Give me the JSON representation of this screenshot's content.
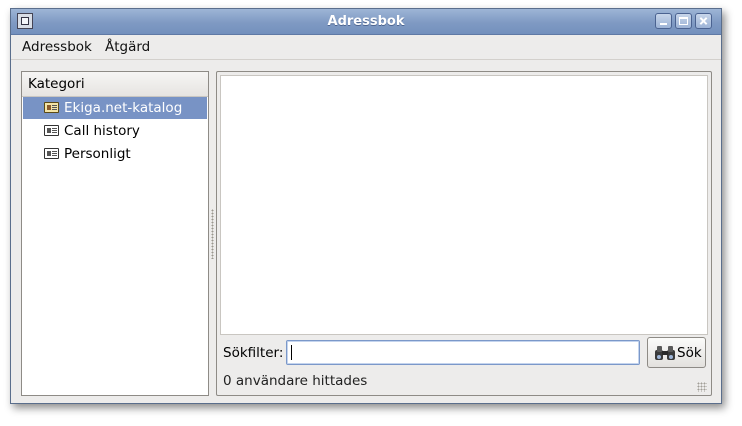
{
  "window": {
    "title": "Adressbok"
  },
  "menubar": {
    "items": [
      {
        "label": "Adressbok"
      },
      {
        "label": "Åtgärd"
      }
    ]
  },
  "category_list": {
    "header": "Kategori",
    "items": [
      {
        "label": "Ekiga.net-katalog",
        "icon": "directory-card-icon",
        "selected": true
      },
      {
        "label": "Call history",
        "icon": "contact-card-icon",
        "selected": false
      },
      {
        "label": "Personligt",
        "icon": "contact-card-icon",
        "selected": false
      }
    ]
  },
  "search": {
    "filter_label": "Sökfilter:",
    "filter_value": "",
    "button_label": "Sök",
    "button_icon": "binoculars-icon"
  },
  "status": {
    "text": "0 användare hittades"
  },
  "colors": {
    "titlebar": "#7f9ac3",
    "selection": "#7893c5",
    "window_bg": "#edeceb"
  }
}
